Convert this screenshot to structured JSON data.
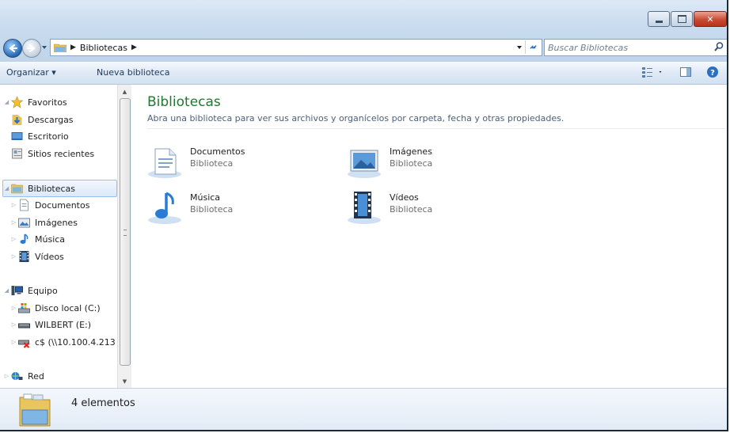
{
  "window": {
    "buttons": {
      "minimize": "minimize",
      "maximize": "maximize",
      "close": "close"
    }
  },
  "address": {
    "crumb": "Bibliotecas",
    "search_placeholder": "Buscar Bibliotecas"
  },
  "toolbar": {
    "organize_label": "Organizar ▾",
    "new_library_label": "Nueva biblioteca"
  },
  "sidebar": {
    "favorites": "Favoritos",
    "downloads": "Descargas",
    "desktop": "Escritorio",
    "recent": "Sitios recientes",
    "libraries": "Bibliotecas",
    "documents": "Documentos",
    "images": "Imágenes",
    "music": "Música",
    "videos": "Vídeos",
    "computer": "Equipo",
    "local_disk": "Disco local (C:)",
    "wilbert": "WILBERT (E:)",
    "network_share": "c$ (\\\\10.100.4.213",
    "network": "Red"
  },
  "content": {
    "title": "Bibliotecas",
    "description": "Abra una biblioteca para ver sus archivos y organícelos por carpeta, fecha y otras propiedades.",
    "libraries": [
      {
        "name": "Documentos",
        "type": "Biblioteca",
        "icon": "documents-library-icon"
      },
      {
        "name": "Imágenes",
        "type": "Biblioteca",
        "icon": "pictures-library-icon"
      },
      {
        "name": "Música",
        "type": "Biblioteca",
        "icon": "music-library-icon"
      },
      {
        "name": "Vídeos",
        "type": "Biblioteca",
        "icon": "videos-library-icon"
      }
    ]
  },
  "status": {
    "text": "4 elementos"
  },
  "colors": {
    "title_green": "#1e7a2e",
    "selection_blue": "#99c0eb"
  }
}
